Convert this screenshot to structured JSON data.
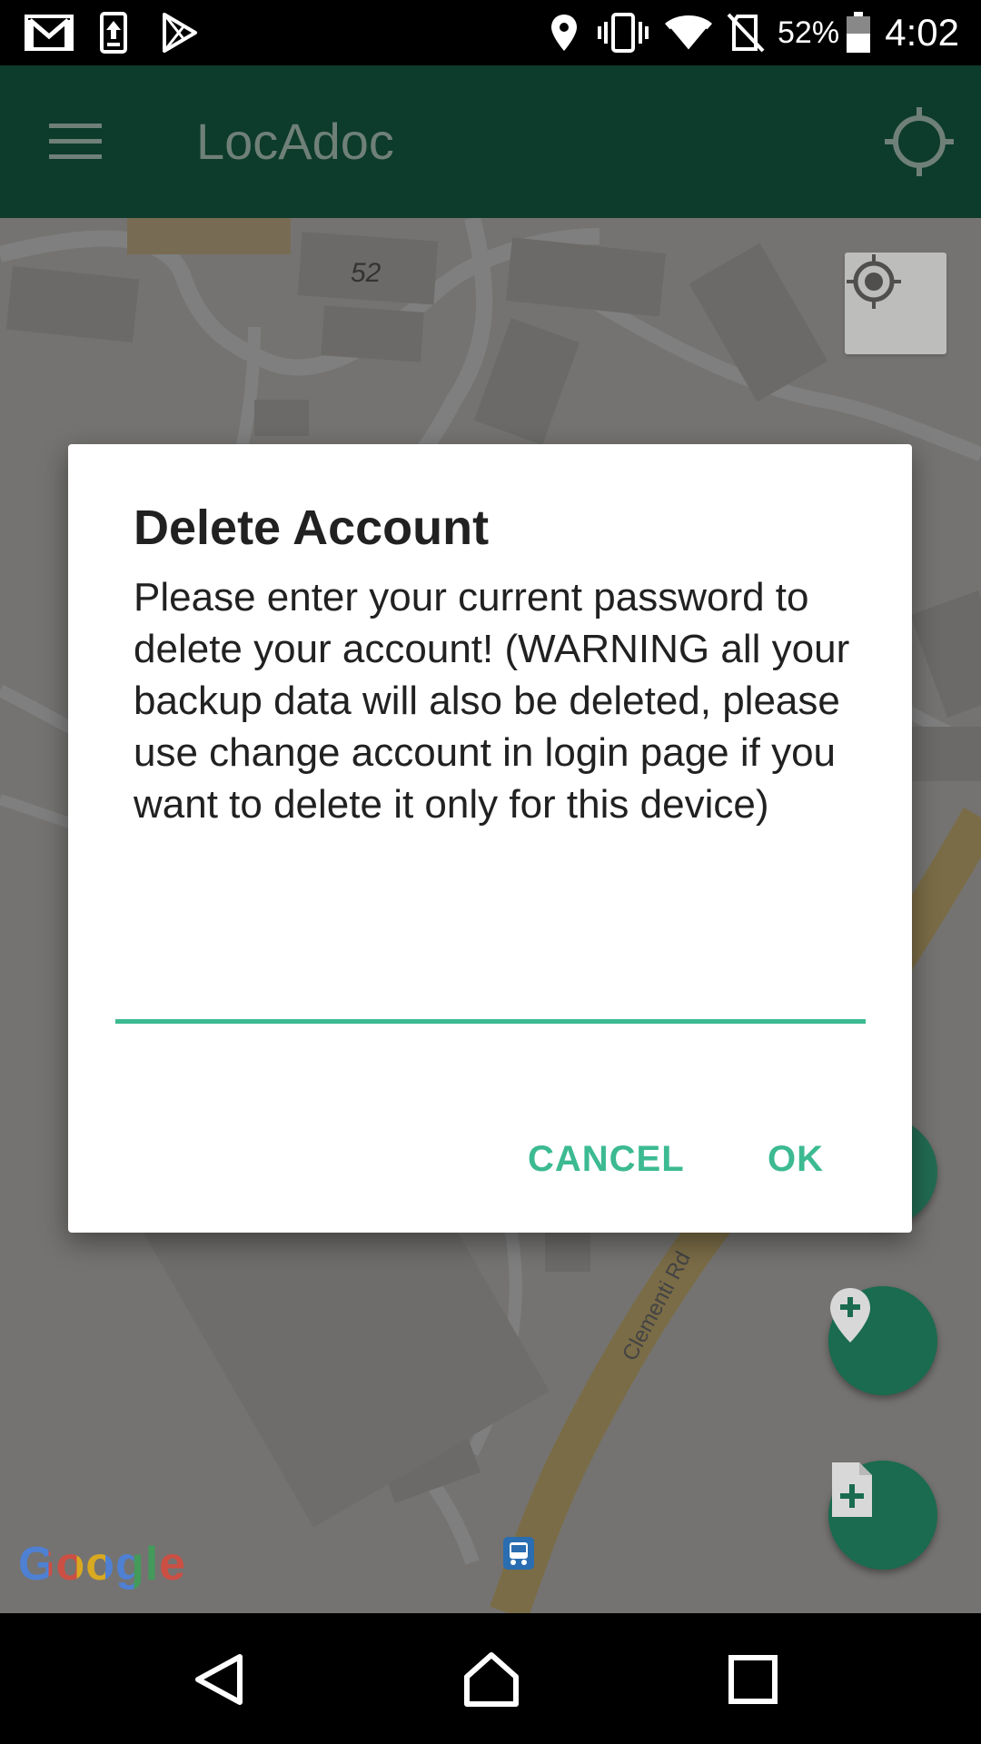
{
  "status_bar": {
    "icons": [
      "gmail-icon",
      "upload-icon",
      "play-store-icon",
      "location-icon",
      "vibrate-icon",
      "wifi-icon",
      "no-sim-icon",
      "battery-icon"
    ],
    "battery_text": "52%",
    "time": "4:02"
  },
  "app_bar": {
    "title": "LocAdoc",
    "menu_icon": "hamburger-menu-icon",
    "gps_icon": "crosshair-icon",
    "background": "#0d3b2c"
  },
  "map": {
    "street_number": "52",
    "road_label": "Clementi Rd",
    "attribution": "Google",
    "my_location_icon": "my-location-icon",
    "fabs": [
      "add-location-icon",
      "add-document-icon"
    ]
  },
  "dialog": {
    "title": "Delete Account",
    "message": "Please enter your current password to delete your account! (WARNING all your backup data will also be deleted, please use change account in login page if you want to delete it only for this device)",
    "password_value": "",
    "cancel_label": "CANCEL",
    "ok_label": "OK",
    "accent_color": "#3cba92"
  },
  "nav_bar": {
    "back_icon": "back-triangle-icon",
    "home_icon": "home-icon",
    "recents_icon": "recents-square-icon"
  }
}
